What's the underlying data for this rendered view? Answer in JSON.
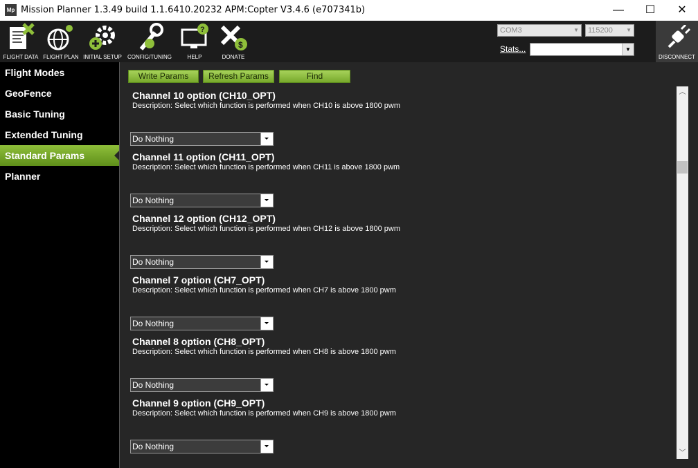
{
  "window": {
    "title": "Mission Planner 1.3.49 build 1.1.6410.20232 APM:Copter V3.4.6 (e707341b)",
    "logo_text": "Mp",
    "controls": {
      "minimize": "—",
      "maximize": "☐",
      "close": "✕"
    }
  },
  "toolbar": {
    "buttons": [
      {
        "label": "FLIGHT DATA",
        "icon": "flight-data-icon"
      },
      {
        "label": "FLIGHT PLAN",
        "icon": "flight-plan-icon"
      },
      {
        "label": "INITIAL SETUP",
        "icon": "initial-setup-icon"
      },
      {
        "label": "CONFIG/TUNING",
        "icon": "config-tuning-icon"
      },
      {
        "label": "HELP",
        "icon": "help-icon"
      },
      {
        "label": "DONATE",
        "icon": "donate-icon"
      }
    ],
    "port": "COM3",
    "baud": "115200",
    "stats_label": "Stats...",
    "stats_value": "",
    "disconnect_label": "DISCONNECT"
  },
  "sidebar": {
    "items": [
      {
        "label": "Flight Modes",
        "active": false
      },
      {
        "label": "GeoFence",
        "active": false
      },
      {
        "label": "Basic Tuning",
        "active": false
      },
      {
        "label": "Extended Tuning",
        "active": false
      },
      {
        "label": "Standard Params",
        "active": true
      },
      {
        "label": "Planner",
        "active": false
      }
    ]
  },
  "actions": {
    "write_params": "Write Params",
    "refresh_params": "Refresh Params",
    "find": "Find"
  },
  "params": [
    {
      "title": "Channel 10 option (CH10_OPT)",
      "description": "Description: Select which function is performed when CH10 is above 1800 pwm",
      "value": "Do Nothing"
    },
    {
      "title": "Channel 11 option (CH11_OPT)",
      "description": "Description: Select which function is performed when CH11 is above 1800 pwm",
      "value": "Do Nothing"
    },
    {
      "title": "Channel 12 option (CH12_OPT)",
      "description": "Description: Select which function is performed when CH12 is above 1800 pwm",
      "value": "Do Nothing"
    },
    {
      "title": "Channel 7 option (CH7_OPT)",
      "description": "Description: Select which function is performed when CH7 is above 1800 pwm",
      "value": "Do Nothing"
    },
    {
      "title": "Channel 8 option (CH8_OPT)",
      "description": "Description: Select which function is performed when CH8 is above 1800 pwm",
      "value": "Do Nothing"
    },
    {
      "title": "Channel 9 option (CH9_OPT)",
      "description": "Description: Select which function is performed when CH9 is above 1800 pwm",
      "value": "Do Nothing"
    }
  ],
  "colors": {
    "accent_green": "#8fbf3a",
    "background": "#262626",
    "sidebar": "#000000"
  }
}
